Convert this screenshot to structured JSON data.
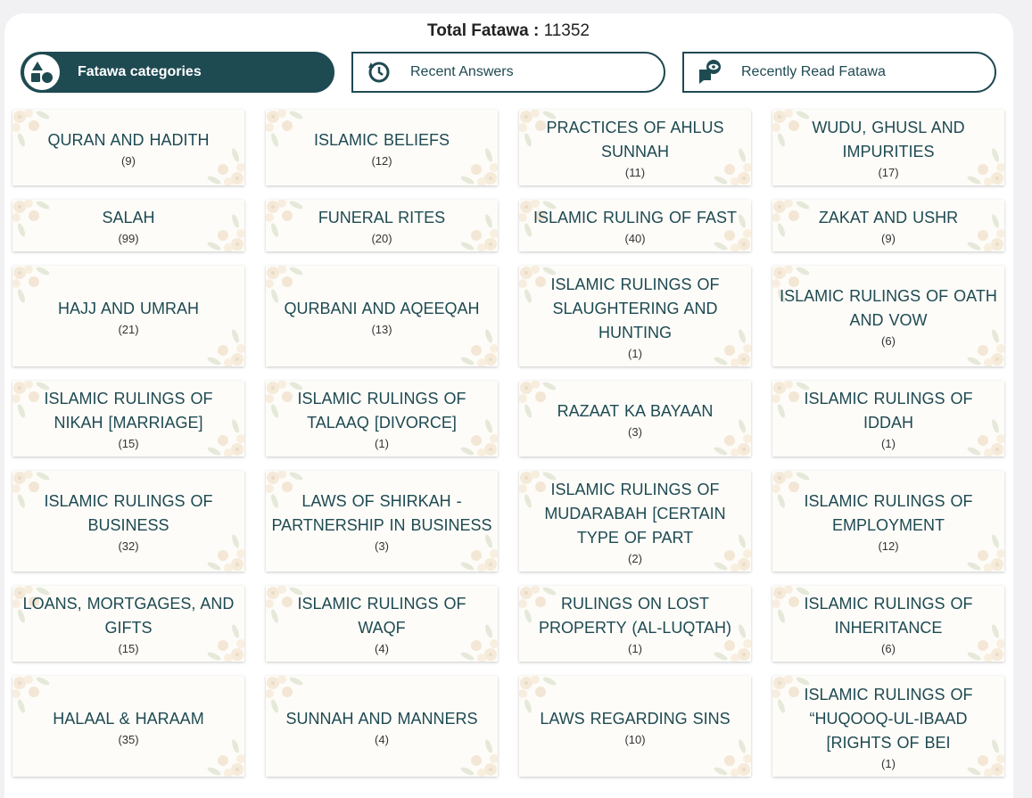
{
  "header": {
    "total_label": "Total Fatawa :",
    "total_value": "11352"
  },
  "tabs": [
    {
      "label": "Fatawa categories",
      "icon": "shapes-icon",
      "active": true
    },
    {
      "label": "Recent Answers",
      "icon": "history-icon",
      "active": false
    },
    {
      "label": "Recently Read Fatawa",
      "icon": "read-eye-icon",
      "active": false
    }
  ],
  "categories": [
    {
      "title": "QURAN AND HADITH",
      "count": "(9)"
    },
    {
      "title": "ISLAMIC BELIEFS",
      "count": "(12)"
    },
    {
      "title": "PRACTICES OF AHLUS SUNNAH",
      "count": "(11)"
    },
    {
      "title": "WUDU, GHUSL AND IMPURITIES",
      "count": "(17)"
    },
    {
      "title": "SALAH",
      "count": "(99)"
    },
    {
      "title": "FUNERAL RITES",
      "count": "(20)"
    },
    {
      "title": "ISLAMIC RULING OF FAST",
      "count": "(40)"
    },
    {
      "title": "ZAKAT AND USHR",
      "count": "(9)"
    },
    {
      "title": "HAJJ AND UMRAH",
      "count": "(21)"
    },
    {
      "title": "QURBANI AND AQEEQAH",
      "count": "(13)"
    },
    {
      "title": "ISLAMIC RULINGS OF SLAUGHTERING AND HUNTING",
      "count": "(1)"
    },
    {
      "title": "ISLAMIC RULINGS OF OATH AND VOW",
      "count": "(6)"
    },
    {
      "title": "ISLAMIC RULINGS OF NIKAH [MARRIAGE]",
      "count": "(15)"
    },
    {
      "title": "ISLAMIC RULINGS OF TALAAQ [DIVORCE]",
      "count": "(1)"
    },
    {
      "title": "RAZAAT KA BAYAAN",
      "count": "(3)"
    },
    {
      "title": "ISLAMIC RULINGS OF IDDAH",
      "count": "(1)"
    },
    {
      "title": "ISLAMIC RULINGS OF BUSINESS",
      "count": "(32)"
    },
    {
      "title": "LAWS OF SHIRKAH - PARTNERSHIP IN BUSINESS",
      "count": "(3)"
    },
    {
      "title": "ISLAMIC RULINGS OF MUDARABAH [CERTAIN TYPE OF PART",
      "count": "(2)"
    },
    {
      "title": "ISLAMIC RULINGS OF EMPLOYMENT",
      "count": "(12)"
    },
    {
      "title": "LOANS, MORTGAGES, AND GIFTS",
      "count": "(15)"
    },
    {
      "title": "ISLAMIC RULINGS OF WAQF",
      "count": "(4)"
    },
    {
      "title": "RULINGS ON LOST PROPERTY (AL-LUQTAH)",
      "count": "(1)"
    },
    {
      "title": "ISLAMIC RULINGS OF INHERITANCE",
      "count": "(6)"
    },
    {
      "title": "HALAAL & HARAAM",
      "count": "(35)"
    },
    {
      "title": "SUNNAH AND MANNERS",
      "count": "(4)"
    },
    {
      "title": "LAWS REGARDING SINS",
      "count": "(10)"
    },
    {
      "title": "ISLAMIC RULINGS OF “HUQOOQ-UL-IBAAD [RIGHTS OF BEI",
      "count": "(1)"
    }
  ],
  "colors": {
    "primary": "#1e4a52",
    "card_bg": "#fdfcf8",
    "page_bg": "#f1f1f3"
  }
}
